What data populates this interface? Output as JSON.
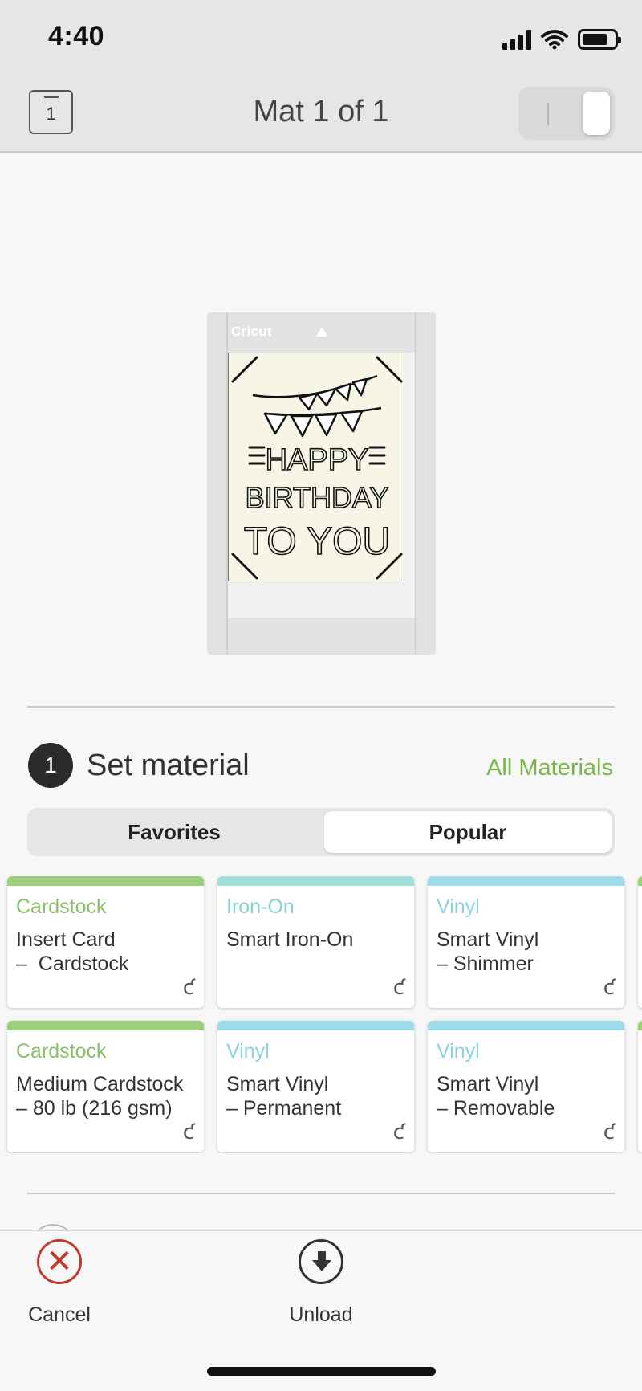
{
  "status_bar": {
    "time": "4:40"
  },
  "header": {
    "mat_number": "1",
    "title": "Mat 1 of 1"
  },
  "mat": {
    "brand": "Cricut",
    "design_text": [
      "HAPPY",
      "BIRTHDAY",
      "TO YOU"
    ]
  },
  "material_section": {
    "step": "1",
    "title": "Set material",
    "all_materials_link": "All Materials",
    "tabs": [
      {
        "label": "Favorites",
        "selected": false
      },
      {
        "label": "Popular",
        "selected": true
      }
    ],
    "tiles": [
      {
        "category": "Cardstock",
        "name": "Insert Card\n–  Cardstock",
        "color": "#9bcf7c",
        "text_color": "#8ac06a"
      },
      {
        "category": "Iron-On",
        "name": "Smart Iron-On",
        "color": "#9fdfd8",
        "text_color": "#8ad3cb"
      },
      {
        "category": "Vinyl",
        "name": "Smart Vinyl\n– Shimmer",
        "color": "#9fdcea",
        "text_color": "#8ad2e2"
      },
      {
        "category": "Cardstock",
        "name": "Medium Cardstock\n– 80 lb (216 gsm)",
        "color": "#9bcf7c",
        "text_color": "#8ac06a"
      },
      {
        "category": "Vinyl",
        "name": "Smart Vinyl\n– Permanent",
        "color": "#9fdcea",
        "text_color": "#8ad2e2"
      },
      {
        "category": "Vinyl",
        "name": "Smart Vinyl\n– Removable",
        "color": "#9fdcea",
        "text_color": "#8ad2e2"
      }
    ],
    "tile_logo": "ƈ"
  },
  "bottom_bar": {
    "cancel_label": "Cancel",
    "unload_label": "Unload"
  },
  "colors": {
    "accent_green": "#7ab648",
    "cancel_red": "#c0392b"
  }
}
